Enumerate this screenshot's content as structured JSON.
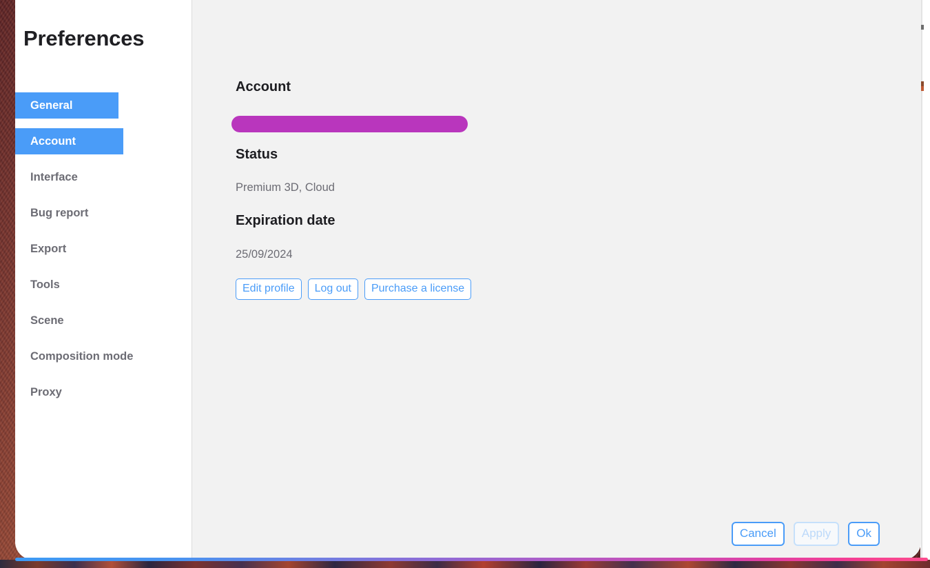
{
  "window": {
    "title": "Preferences"
  },
  "sidebar": {
    "items": [
      {
        "label": "General",
        "state": "highlighted"
      },
      {
        "label": "Account",
        "state": "selected"
      },
      {
        "label": "Interface",
        "state": "normal"
      },
      {
        "label": "Bug report",
        "state": "normal"
      },
      {
        "label": "Export",
        "state": "normal"
      },
      {
        "label": "Tools",
        "state": "normal"
      },
      {
        "label": "Scene",
        "state": "normal"
      },
      {
        "label": "Composition mode",
        "state": "normal"
      },
      {
        "label": "Proxy",
        "state": "normal"
      }
    ]
  },
  "main": {
    "account_heading": "Account",
    "account_email_redacted": true,
    "status_heading": "Status",
    "status_value": "Premium 3D, Cloud",
    "expiration_heading": "Expiration date",
    "expiration_value": "25/09/2024",
    "actions": [
      {
        "label": "Edit profile",
        "name": "edit-profile-button"
      },
      {
        "label": "Log out",
        "name": "log-out-button"
      },
      {
        "label": "Purchase a license",
        "name": "purchase-license-button"
      }
    ]
  },
  "footer": {
    "cancel_label": "Cancel",
    "apply_label": "Apply",
    "apply_enabled": false,
    "ok_label": "Ok"
  },
  "colors": {
    "accent_blue": "#4a9cf8",
    "redaction_magenta": "#b936bd",
    "sidebar_bg": "#ffffff",
    "content_bg": "#f2f2f2",
    "heading_text": "#1d1d21",
    "muted_text": "#6c6c74",
    "disabled_blue": "#bcd9fa"
  }
}
